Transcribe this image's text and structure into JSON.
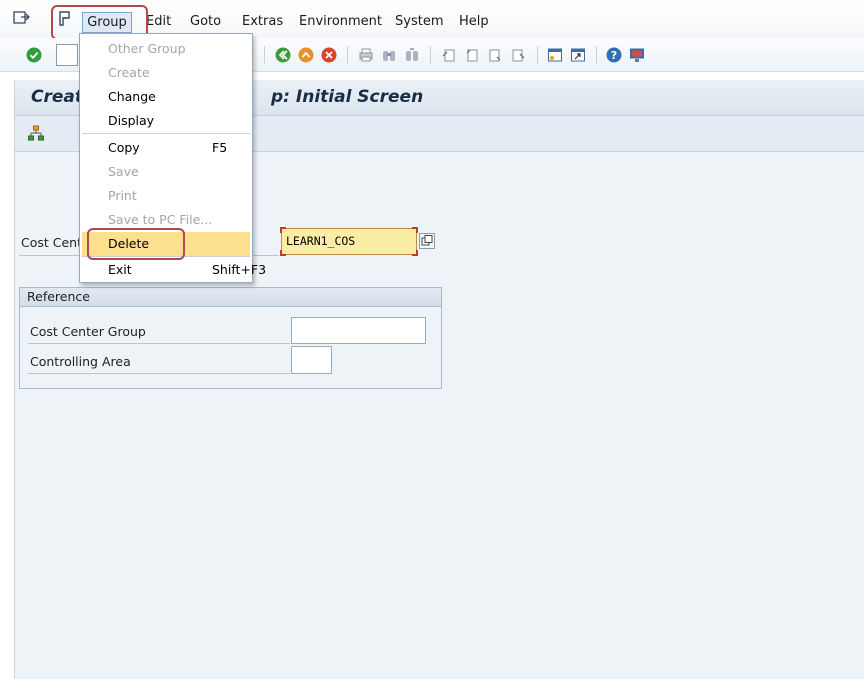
{
  "menubar": {
    "items": [
      {
        "label": "Group",
        "key": "G"
      },
      {
        "label": "Edit",
        "key": "E"
      },
      {
        "label": "Goto",
        "key": "G"
      },
      {
        "label": "Extras",
        "key": "x"
      },
      {
        "label": "Environment",
        "key": "v"
      },
      {
        "label": "System",
        "key": "S"
      },
      {
        "label": "Help",
        "key": "H"
      }
    ]
  },
  "title": "Creat",
  "title_suffix": "p: Initial Screen",
  "form": {
    "cost_center_label": "Cost Cent",
    "cost_center_value": "LEARN1_COS"
  },
  "reference": {
    "header": "Reference",
    "group_label": "Cost Center Group",
    "group_value": "",
    "area_label": "Controlling Area",
    "area_value": ""
  },
  "dropdown": {
    "items": [
      {
        "label": "Other Group",
        "shortcut": "",
        "disabled": true
      },
      {
        "label": "Create",
        "shortcut": "",
        "disabled": true
      },
      {
        "label": "Change",
        "shortcut": "",
        "disabled": false
      },
      {
        "label": "Display",
        "shortcut": "",
        "disabled": false
      },
      {
        "label": "Copy",
        "shortcut": "F5",
        "disabled": false
      },
      {
        "label": "Save",
        "shortcut": "",
        "disabled": true
      },
      {
        "label": "Print",
        "shortcut": "",
        "disabled": true
      },
      {
        "label": "Save to PC File...",
        "shortcut": "",
        "disabled": true
      },
      {
        "label": "Delete",
        "shortcut": "",
        "disabled": false,
        "active": true
      },
      {
        "label": "Exit",
        "shortcut": "Shift+F3",
        "disabled": false
      }
    ]
  },
  "colors": {
    "highlight_outline": "#b04a4a",
    "active_item": "#fde08f",
    "required_field": "#fbeea4",
    "ok_green": "#2e9e3e"
  }
}
